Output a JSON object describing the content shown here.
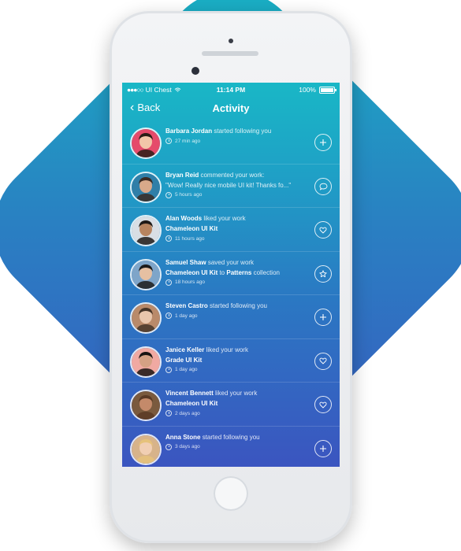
{
  "status_bar": {
    "carrier": "UI Chest",
    "time": "11:14 PM",
    "battery": "100%"
  },
  "nav": {
    "back_label": "Back",
    "title": "Activity"
  },
  "items": [
    {
      "name": "Barbara Jordan",
      "action": "started following you",
      "detail": "",
      "detail_extra": "",
      "time": "27 min ago",
      "button_icon": "plus-icon"
    },
    {
      "name": "Bryan Reid",
      "action": "commented your work:",
      "detail": "\"Wow! Really nice mobile UI kit! Thanks fo...\"",
      "detail_extra": "",
      "time": "5 hours ago",
      "button_icon": "comment-icon"
    },
    {
      "name": "Alan Woods",
      "action": "liked your work",
      "detail": "Chameleon UI Kit",
      "detail_extra": "",
      "time": "11 hours ago",
      "button_icon": "heart-icon"
    },
    {
      "name": "Samuel Shaw",
      "action": "saved your work",
      "detail": "Chameleon UI Kit",
      "detail_extra": " to ",
      "detail_link2": "Patterns",
      "detail_extra2": " collection",
      "time": "18 hours ago",
      "button_icon": "star-icon"
    },
    {
      "name": "Steven Castro",
      "action": "started following you",
      "detail": "",
      "detail_extra": "",
      "time": "1 day ago",
      "button_icon": "plus-icon"
    },
    {
      "name": "Janice Keller",
      "action": "liked your work",
      "detail": "Grade UI Kit",
      "detail_extra": "",
      "time": "1 day ago",
      "button_icon": "heart-icon"
    },
    {
      "name": "Vincent Bennett",
      "action": "liked your work",
      "detail": "Chameleon UI Kit",
      "detail_extra": "",
      "time": "2 days ago",
      "button_icon": "heart-icon"
    },
    {
      "name": "Anna Stone",
      "action": "started following you",
      "detail": "",
      "detail_extra": "",
      "time": "3 days ago",
      "button_icon": "plus-icon"
    }
  ]
}
